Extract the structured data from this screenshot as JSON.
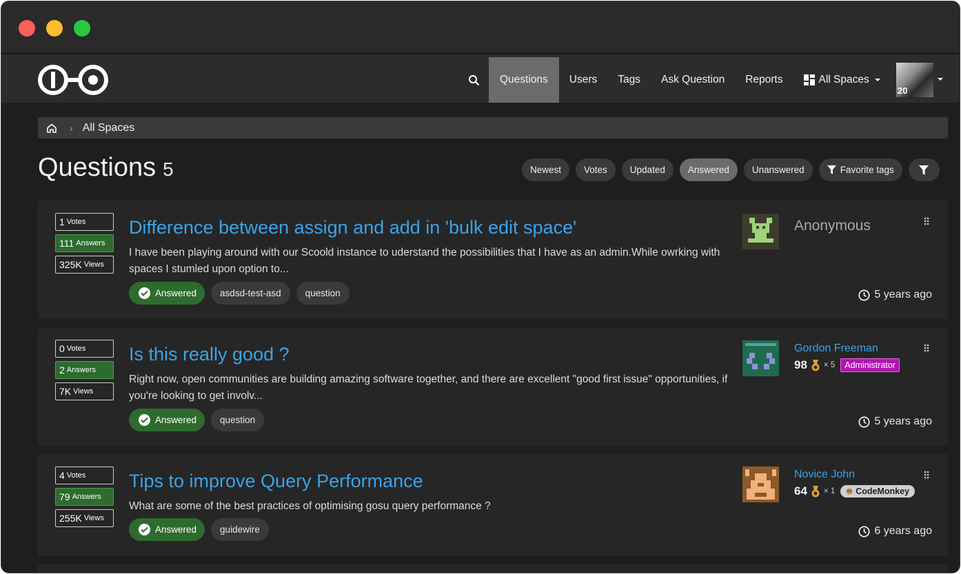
{
  "nav": {
    "items": [
      {
        "label": "Questions",
        "active": true
      },
      {
        "label": "Users"
      },
      {
        "label": "Tags"
      },
      {
        "label": "Ask Question"
      },
      {
        "label": "Reports"
      }
    ],
    "spaces_label": "All Spaces",
    "avatar_badge": "20"
  },
  "breadcrumb": {
    "label": "All Spaces"
  },
  "page": {
    "title": "Questions",
    "count": "5"
  },
  "filters": {
    "newest": "Newest",
    "votes": "Votes",
    "updated": "Updated",
    "answered": "Answered",
    "unanswered": "Unanswered",
    "favorite_tags": "Favorite tags"
  },
  "questions": [
    {
      "votes": "1",
      "votes_label": "Votes",
      "answers": "111",
      "answers_label": "Answers",
      "views": "325K",
      "views_label": "Views",
      "title": "Difference between assign and add in 'bulk edit space'",
      "excerpt": "I have been playing around with our Scoold instance to uderstand the possibilities that I have as an admin.While owrking with spaces I stumled upon option to...",
      "answered_label": "Answered",
      "tags": [
        "asdsd-test-asd",
        "question"
      ],
      "author": "Anonymous",
      "time": "5 years ago"
    },
    {
      "votes": "0",
      "votes_label": "Votes",
      "answers": "2",
      "answers_label": "Answers",
      "views": "7K",
      "views_label": "Views",
      "title": "Is this really good ?",
      "excerpt": "Right now, open communities are building amazing software together, and there are excellent \"good first issue\" opportunities, if you're looking to get involv...",
      "answered_label": "Answered",
      "tags": [
        "question"
      ],
      "author": "Gordon Freeman",
      "rep": "98",
      "medals": "× 5",
      "badge": "Administrator",
      "time": "5 years ago"
    },
    {
      "votes": "4",
      "votes_label": "Votes",
      "answers": "79",
      "answers_label": "Answers",
      "views": "255K",
      "views_label": "Views",
      "title": "Tips to improve Query Performance",
      "excerpt": "What are some of the best practices of optimising gosu query performance ?",
      "answered_label": "Answered",
      "tags": [
        "guidewire"
      ],
      "author": "Novice John",
      "rep": "64",
      "medals": "× 1",
      "badge": "CodeMonkey",
      "time": "6 years ago"
    }
  ],
  "colors": {
    "accent_link": "#3aa3e8",
    "answered_green": "#2e6b2e",
    "admin_badge": "#b214b2"
  }
}
